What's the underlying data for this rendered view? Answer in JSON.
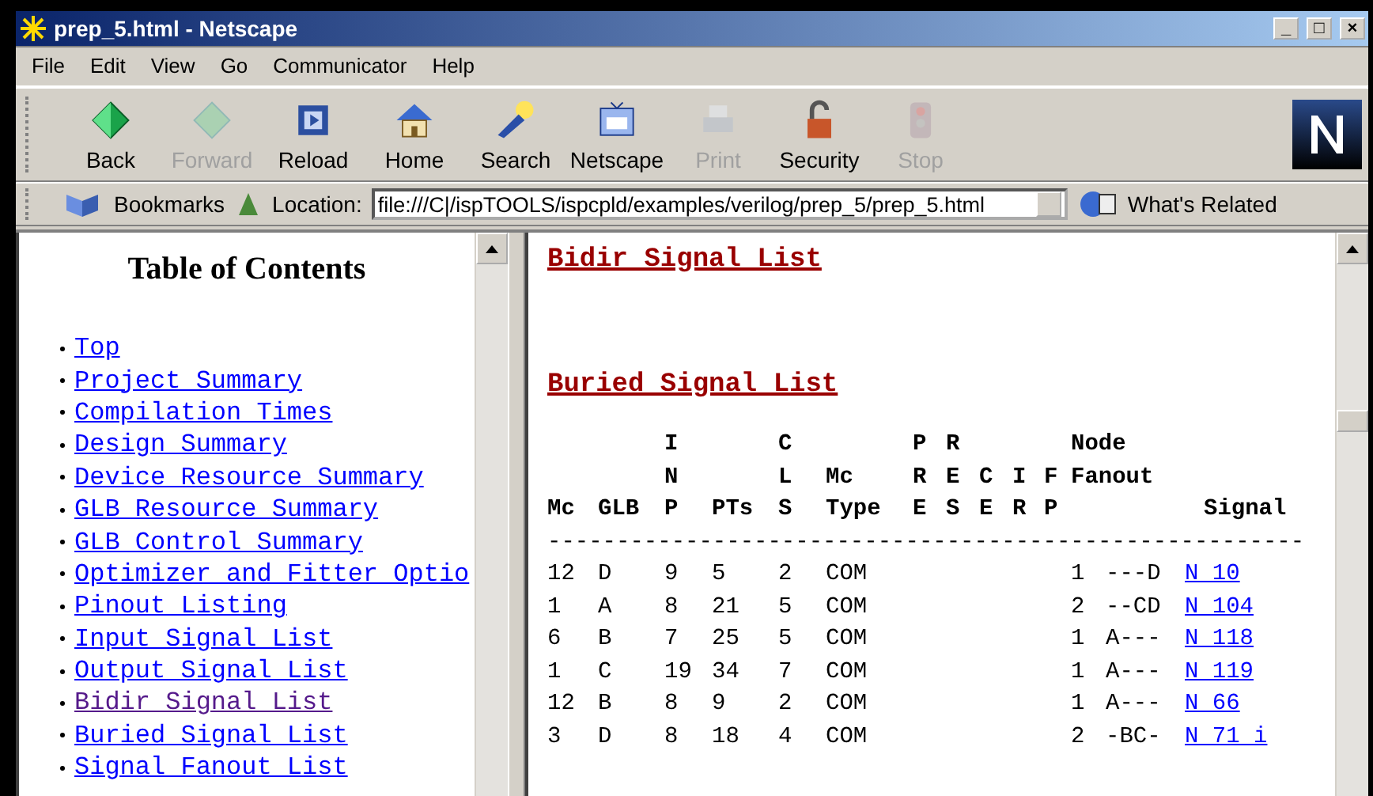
{
  "window": {
    "title": "prep_5.html - Netscape",
    "controls": [
      "_",
      "□",
      "×"
    ]
  },
  "menu": [
    {
      "label": "File"
    },
    {
      "label": "Edit"
    },
    {
      "label": "View"
    },
    {
      "label": "Go"
    },
    {
      "label": "Communicator"
    },
    {
      "label": "Help"
    }
  ],
  "toolbar": [
    {
      "label": "Back",
      "disabled": false
    },
    {
      "label": "Forward",
      "disabled": true
    },
    {
      "label": "Reload",
      "disabled": false
    },
    {
      "label": "Home",
      "disabled": false
    },
    {
      "label": "Search",
      "disabled": false
    },
    {
      "label": "Netscape",
      "disabled": false
    },
    {
      "label": "Print",
      "disabled": true
    },
    {
      "label": "Security",
      "disabled": false
    },
    {
      "label": "Stop",
      "disabled": true
    }
  ],
  "location_bar": {
    "bookmarks": "Bookmarks",
    "location_label": "Location:",
    "url": "file:///C|/ispTOOLS/ispcpld/examples/verilog/prep_5/prep_5.html",
    "whats_related": "What's Related"
  },
  "toc": {
    "title": "Table of Contents",
    "items": [
      {
        "label": "Top",
        "visited": false
      },
      {
        "label": "Project Summary",
        "visited": false
      },
      {
        "label": "Compilation Times",
        "visited": false
      },
      {
        "label": "Design Summary",
        "visited": false
      },
      {
        "label": "Device Resource Summary",
        "visited": false
      },
      {
        "label": "GLB Resource Summary",
        "visited": false
      },
      {
        "label": "GLB Control Summary",
        "visited": false
      },
      {
        "label": "Optimizer and Fitter Optio",
        "visited": false
      },
      {
        "label": "Pinout Listing",
        "visited": false
      },
      {
        "label": "Input Signal List",
        "visited": false
      },
      {
        "label": "Output Signal List",
        "visited": false
      },
      {
        "label": "Bidir Signal List",
        "visited": true
      },
      {
        "label": "Buried Signal List",
        "visited": false
      },
      {
        "label": "Signal Fanout List",
        "visited": false
      }
    ]
  },
  "sections": [
    {
      "heading": "Bidir Signal List"
    },
    {
      "heading": "Buried Signal List"
    }
  ],
  "table": {
    "header_rows": [
      [
        null,
        null,
        "I",
        null,
        "C",
        null,
        "P",
        "R",
        null,
        null,
        null,
        "Node",
        null,
        null
      ],
      [
        null,
        null,
        "N",
        null,
        "L",
        "Mc",
        "R",
        "E",
        "C",
        "I",
        "F",
        "Fanout",
        null,
        null
      ],
      [
        "Mc",
        "GLB",
        "P",
        "PTs",
        "S",
        "Type",
        "E",
        "S",
        "E",
        "R",
        "P",
        null,
        null,
        "Signal"
      ]
    ],
    "rule": "-------------------------------------------------------",
    "rows": [
      [
        "12",
        "D",
        "9",
        "5",
        "2",
        "COM",
        null,
        null,
        null,
        null,
        null,
        "1",
        "---D",
        "N 10"
      ],
      [
        "1",
        "A",
        "8",
        "21",
        "5",
        "COM",
        null,
        null,
        null,
        null,
        null,
        "2",
        "--CD",
        "N 104"
      ],
      [
        "6",
        "B",
        "7",
        "25",
        "5",
        "COM",
        null,
        null,
        null,
        null,
        null,
        "1",
        "A---",
        "N 118"
      ],
      [
        "1",
        "C",
        "19",
        "34",
        "7",
        "COM",
        null,
        null,
        null,
        null,
        null,
        "1",
        "A---",
        "N 119"
      ],
      [
        "12",
        "B",
        "8",
        "9",
        "2",
        "COM",
        null,
        null,
        null,
        null,
        null,
        "1",
        "A---",
        "N 66"
      ],
      [
        "3",
        "D",
        "8",
        "18",
        "4",
        "COM",
        null,
        null,
        null,
        null,
        null,
        "2",
        "-BC-",
        "N 71 i"
      ]
    ]
  }
}
